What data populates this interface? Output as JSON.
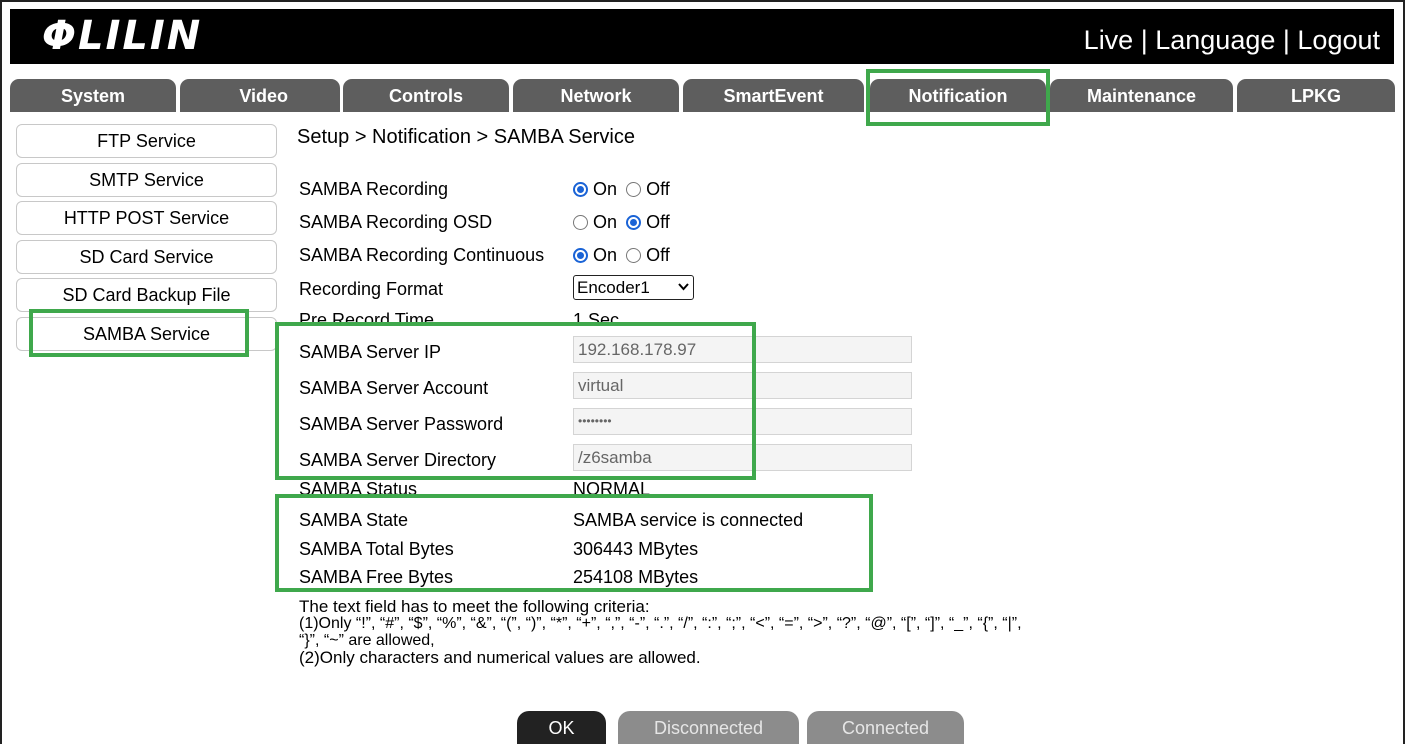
{
  "brand": {
    "logo": "ΦLILIN"
  },
  "header": {
    "live": "Live",
    "sep1": " | ",
    "language": "Language",
    "sep2": " | ",
    "logout": "Logout"
  },
  "tabs": [
    "System",
    "Video",
    "Controls",
    "Network",
    "SmartEvent",
    "Notification",
    "Maintenance",
    "LPKG"
  ],
  "sidebar": [
    "FTP Service",
    "SMTP Service",
    "HTTP POST Service",
    "SD Card Service",
    "SD Card Backup File",
    "SAMBA Service"
  ],
  "breadcrumb": "Setup > Notification > SAMBA Service",
  "form": {
    "recording": {
      "label": "SAMBA Recording",
      "on": "On",
      "off": "Off",
      "value": "On"
    },
    "osd": {
      "label": "SAMBA Recording OSD",
      "on": "On",
      "off": "Off",
      "value": "Off"
    },
    "continuous": {
      "label": "SAMBA Recording Continuous",
      "on": "On",
      "off": "Off",
      "value": "On"
    },
    "format": {
      "label": "Recording Format",
      "value": "Encoder1"
    },
    "prerecord": {
      "label": "Pre Record Time",
      "value": "1 Sec"
    },
    "server_ip": {
      "label": "SAMBA Server IP",
      "value": "192.168.178.97"
    },
    "account": {
      "label": "SAMBA Server Account",
      "value": "virtual"
    },
    "password": {
      "label": "SAMBA Server Password",
      "value": "••••••••"
    },
    "directory": {
      "label": "SAMBA Server Directory",
      "value": "/z6samba"
    },
    "status": {
      "label": "SAMBA Status",
      "value": "NORMAL"
    },
    "state": {
      "label": "SAMBA State",
      "value": "SAMBA service is connected"
    },
    "total": {
      "label": "SAMBA Total Bytes",
      "value": "306443 MBytes"
    },
    "free": {
      "label": "SAMBA Free Bytes",
      "value": "254108 MBytes"
    }
  },
  "notes": {
    "line1": "The text field has to meet the following criteria:",
    "line2": "(1)Only “!”, “#”, “$”, “%”, “&”, “(”, “)”, “*”, “+”, “,”, “-”, “.”, “/”, “:”, “;”, “<”, “=”, “>”, “?”, “@”, “[”, “]”, “_”, “{”, “|”,",
    "line3": "“}”, “~” are allowed,",
    "line4": "(2)Only characters and numerical values are allowed."
  },
  "buttons": {
    "ok": "OK",
    "disconnected": "Disconnected",
    "connected": "Connected"
  },
  "colors": {
    "highlight": "#3fa84c",
    "tab_bg": "#5e5e5e",
    "radio_accent": "#1a63d6"
  }
}
